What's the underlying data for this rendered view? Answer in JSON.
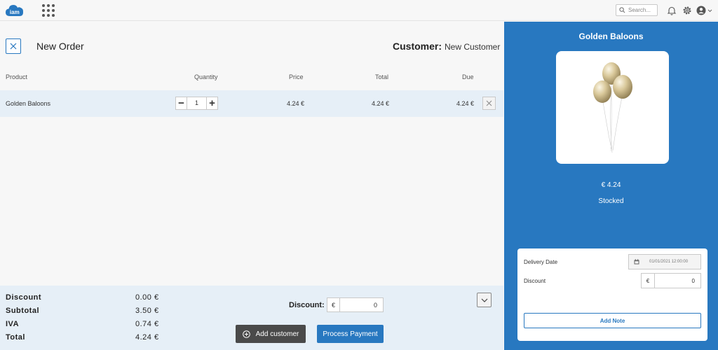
{
  "topbar": {
    "logo_text": "iam",
    "search_placeholder": "Search...",
    "icons": [
      "apps-grid-icon",
      "search-icon",
      "bell-icon",
      "gear-icon",
      "user-icon",
      "chevron-down-icon"
    ]
  },
  "order": {
    "title": "New Order",
    "customer_label": "Customer:",
    "customer_value": "New Customer"
  },
  "table": {
    "headers": [
      "Product",
      "Quantity",
      "Price",
      "Total",
      "Due"
    ],
    "rows": [
      {
        "product": "Golden Baloons",
        "quantity": "1",
        "price": "4.24 €",
        "total": "4.24 €",
        "due": "4.24 €"
      }
    ]
  },
  "summary": {
    "items": [
      {
        "label": "Discount",
        "value": "0.00 €"
      },
      {
        "label": "Subtotal",
        "value": "3.50 €"
      },
      {
        "label": "IVA",
        "value": "0.74 €"
      },
      {
        "label": "Total",
        "value": "4.24 €"
      }
    ],
    "discount_label": "Discount:",
    "discount_currency": "€",
    "discount_value": "0"
  },
  "actions": {
    "add_customer": "Add customer",
    "process_payment": "Process Payment"
  },
  "product_panel": {
    "title": "Golden Baloons",
    "price": "€ 4.24",
    "stock": "Stocked",
    "delivery_label": "Delivery Date",
    "delivery_value": "01/01/2021 12:00:00",
    "discount_label": "Discount",
    "discount_currency": "€",
    "discount_value": "0",
    "add_note": "Add Note"
  },
  "colors": {
    "accent": "#2878c0",
    "row_highlight": "#e6eff7",
    "dark_button": "#4a4a4a",
    "background": "#f7f7f7"
  }
}
